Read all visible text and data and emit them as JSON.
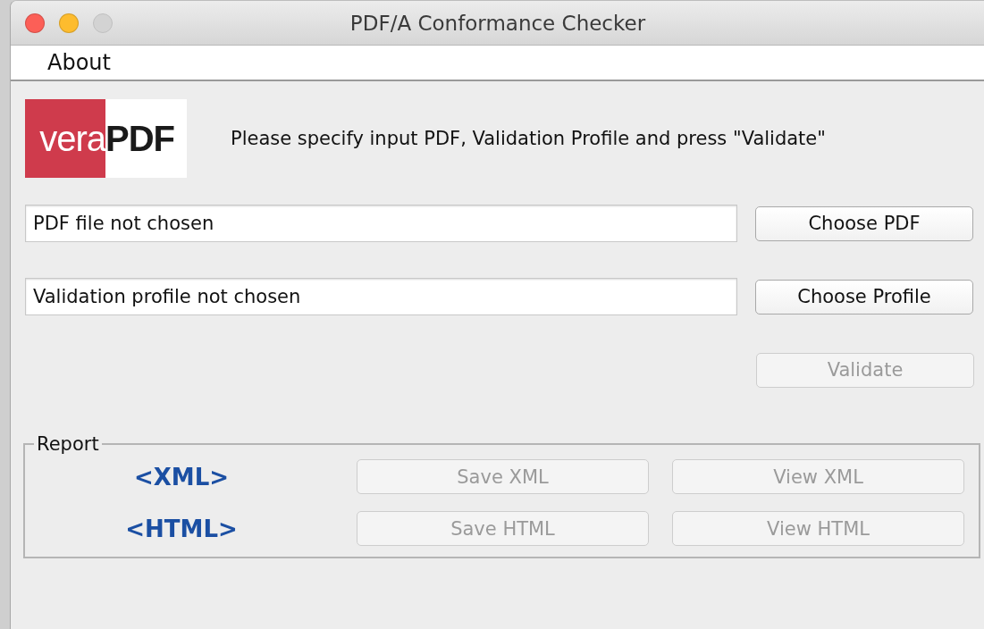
{
  "window": {
    "title": "PDF/A Conformance Checker",
    "controls": [
      {
        "kind": "close",
        "disabled": false
      },
      {
        "kind": "minimize",
        "disabled": false
      },
      {
        "kind": "zoom",
        "disabled": true
      }
    ]
  },
  "menu": [
    {
      "label": "About"
    }
  ],
  "logo": {
    "left": "vera",
    "right": "PDF"
  },
  "instruction": "Please specify input PDF, Validation Profile and press \"Validate\"",
  "inputs": [
    {
      "value": "PDF file not chosen",
      "button": {
        "label": "Choose PDF",
        "disabled": false
      }
    },
    {
      "value": "Validation profile not chosen",
      "button": {
        "label": "Choose Profile",
        "disabled": false
      }
    }
  ],
  "validate": {
    "label": "Validate",
    "disabled": true
  },
  "report": {
    "legend": "Report",
    "rows": [
      {
        "label": "<XML>",
        "save": {
          "label": "Save XML",
          "disabled": true
        },
        "view": {
          "label": "View XML",
          "disabled": true
        }
      },
      {
        "label": "<HTML>",
        "save": {
          "label": "Save HTML",
          "disabled": true
        },
        "view": {
          "label": "View HTML",
          "disabled": true
        }
      }
    ]
  }
}
